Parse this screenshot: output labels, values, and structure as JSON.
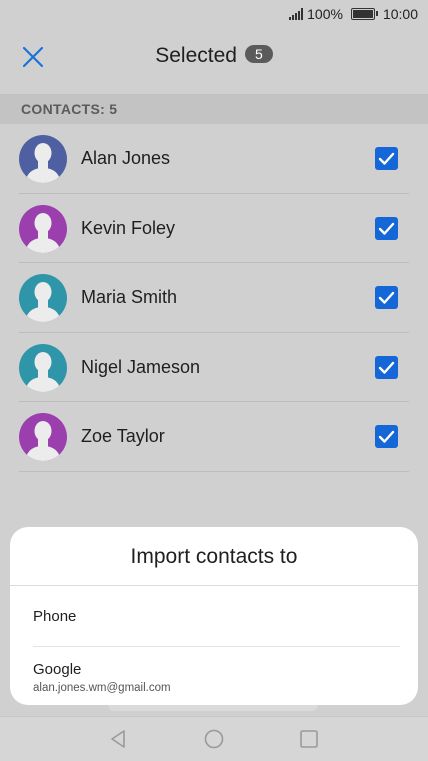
{
  "status_bar": {
    "battery_percent": "100%",
    "time": "10:00"
  },
  "header": {
    "title": "Selected",
    "count": "5"
  },
  "section": {
    "label": "CONTACTS: 5"
  },
  "contacts": [
    {
      "name": "Alan Jones",
      "avatar_color": "#4e5fa2",
      "checked": true
    },
    {
      "name": "Kevin Foley",
      "avatar_color": "#9b3fae",
      "checked": true
    },
    {
      "name": "Maria Smith",
      "avatar_color": "#2f95a8",
      "checked": true
    },
    {
      "name": "Nigel Jameson",
      "avatar_color": "#2f95a8",
      "checked": true
    },
    {
      "name": "Zoe Taylor",
      "avatar_color": "#9b3fae",
      "checked": true
    }
  ],
  "sheet": {
    "title": "Import contacts to",
    "options": [
      {
        "label": "Phone"
      },
      {
        "label": "Google",
        "account": "alan.jones.wm@gmail.com"
      }
    ]
  },
  "colors": {
    "accent": "#1567d8",
    "close_icon": "#1a73d9"
  },
  "icons": [
    "close-icon",
    "signal-icon",
    "battery-icon",
    "avatar-icon",
    "checkbox-checked-icon",
    "back-icon",
    "home-icon",
    "recents-icon"
  ]
}
